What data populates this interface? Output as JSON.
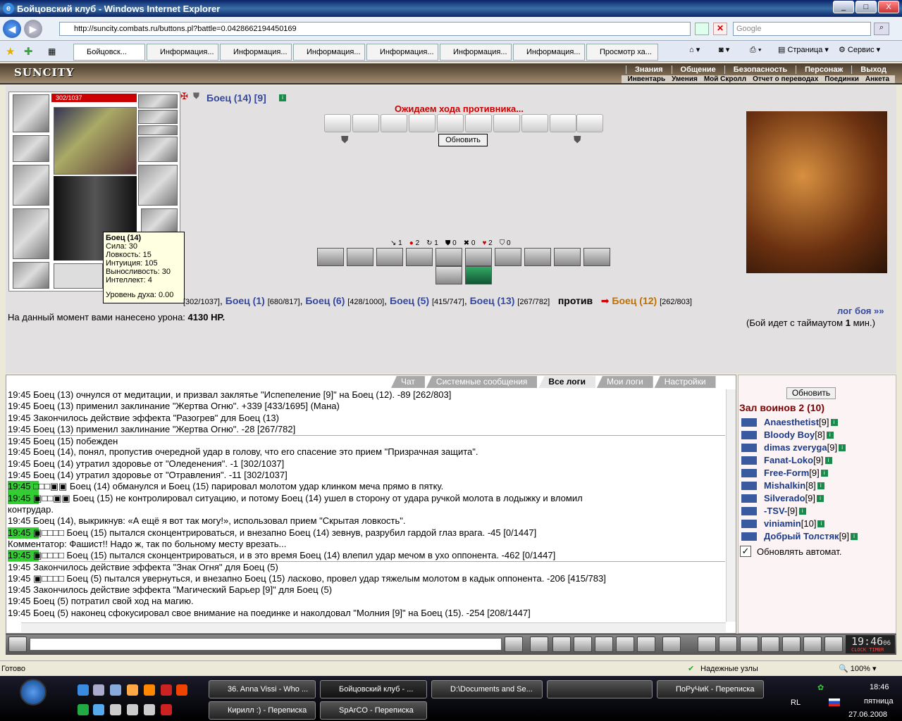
{
  "window": {
    "title": "Бойцовский клуб - Windows Internet Explorer",
    "url": "http://suncity.combats.ru/buttons.pl?battle=0.0428662194450169",
    "search_placeholder": "Google",
    "buttons": [
      "_",
      "□",
      "X"
    ]
  },
  "tabs": [
    {
      "label": "Бойцовск...",
      "active": true
    },
    {
      "label": "Информация..."
    },
    {
      "label": "Информация..."
    },
    {
      "label": "Информация..."
    },
    {
      "label": "Информация..."
    },
    {
      "label": "Информация..."
    },
    {
      "label": "Информация..."
    },
    {
      "label": "Просмотр ха..."
    }
  ],
  "ie_tools": {
    "page": "Страница",
    "service": "Сервис"
  },
  "game": {
    "logo": "SUNCITY",
    "menu_top": [
      "Знания",
      "Общение",
      "Безопасность",
      "Персонаж",
      "Выход"
    ],
    "menu_bottom": [
      "Инвентарь",
      "Умения",
      "Мой Скролл",
      "Отчет о переводах",
      "Поединки",
      "Анкета"
    ],
    "hp": "302/1037",
    "player_name": "Боец (14) [9]",
    "waiting": "Ожидаем хода противника...",
    "refresh": "Обновить",
    "stat_counts": [
      "1",
      "2",
      "1",
      "0",
      "0",
      "2",
      "0"
    ],
    "tooltip": {
      "title": "Боец (14)",
      "lines": [
        "Сила: 30",
        "Ловкость: 15",
        "Интуиция: 105",
        "Выносливость: 30",
        "Интеллект: 4"
      ],
      "spirit": "Уровень духа: 0.00"
    },
    "team_line": {
      "first_hp": "[302/1037]",
      "b1": "Боец (1)",
      "b1hp": "[680/817]",
      "b6": "Боец (6)",
      "b6hp": "[428/1000]",
      "b5": "Боец (5)",
      "b5hp": "[415/747]",
      "b13": "Боец (13)",
      "b13hp": "[267/782]",
      "vs": "против",
      "b12": "Боец (12)",
      "b12hp": "[262/803]"
    },
    "damage_text": "На данный момент вами нанесено урона:",
    "damage_value": "4130 HP.",
    "log_link": "лог боя »»",
    "timeout": "(Бой идет с таймаутом",
    "timeout_val": "1",
    "timeout_end": "мин.)"
  },
  "chat": {
    "tabs": [
      "Чат",
      "Системные сообщения",
      "Все логи",
      "Мои логи",
      "Настройки"
    ],
    "lines": [
      "19:45 Боец (13) очнулся от медитации, и призвал заклятье \"Испепеление [9]\" на Боец (12). -89 [262/803]",
      "19:45 Боец (13) применил заклинание \"Жертва Огню\". +339 [433/1695] (Мана)",
      "19:45 Закончилось действие эффекта \"Разогрев\" для Боец (13)",
      "19:45 Боец (13) применил заклинание \"Жертва Огню\". -28 [267/782]",
      "19:45 Боец (15) побежден",
      "19:45 Боец (14), понял, пропустив очередной удар в голову, что его спасение это прием \"Призрачная защита\".",
      "19:45 Боец (14) утратил здоровье от \"Оледенения\". -1 [302/1037]",
      "19:45 Боец (14) утратил здоровье от \"Отравления\". -11 [302/1037]",
      "19:45 □□□▣▣ Боец (14) обманулся и Боец (15) парировал молотом удар клинком меча прямо в пятку.",
      "19:45 ▣□□▣▣ Боец (15) не контролировал ситуацию, и потому Боец (14) ушел в сторону от удара ручкой молота в лодыжку и вломил",
      "контрудар.",
      "19:45 Боец (14), выкрикнув: «А ещё я вот так могу!», использовал прием \"Скрытая ловкость\".",
      "19:45 ▣□□□□ Боец (15) пытался сконцентрироваться, и внезапно Боец (14) зевнув, разрубил гардой глаз врага. -45 [0/1447]",
      "Комментатор: Фашист!! Надо ж, так по больному месту врезать...",
      "19:45 ▣□□□□ Боец (15) пытался сконцентрироваться, и в это время Боец (14) влепил удар мечом в ухо оппонента. -462 [0/1447]",
      "19:45 Закончилось действие эффекта \"Знак Огня\" для Боец (5)",
      "19:45 ▣□□□□ Боец (5) пытался увернуться, и внезапно Боец (15) ласково, провел удар тяжелым молотом в кадык оппонента. -206 [415/783]",
      "19:45 Закончилось действие эффекта \"Магический Барьер [9]\" для Боец (5)",
      "19:45 Боец (5) потратил свой ход на магию.",
      "19:45 Боец (5) наконец сфокусировал свое внимание на поединке и наколдовал \"Молния [9]\" на Боец (15). -254 [208/1447]"
    ]
  },
  "side": {
    "refresh": "Обновить",
    "room": "Зал воинов 2 (10)",
    "players": [
      {
        "name": "Anaesthetist",
        "lvl": "[9]"
      },
      {
        "name": "Bloody Boy",
        "lvl": "[8]"
      },
      {
        "name": "dimas zveryga",
        "lvl": "[9]"
      },
      {
        "name": "Fanat-Loko",
        "lvl": "[9]"
      },
      {
        "name": "Free-Form",
        "lvl": "[9]"
      },
      {
        "name": "Mishalkin",
        "lvl": "[8]"
      },
      {
        "name": "Silverado",
        "lvl": "[9]"
      },
      {
        "name": "-TSV-",
        "lvl": "[9]"
      },
      {
        "name": "viniamin",
        "lvl": "[10]"
      },
      {
        "name": "Добрый Толстяк",
        "lvl": "[9]"
      }
    ],
    "auto": "Обновлять автомат."
  },
  "clock": {
    "time": "19:46",
    "sec": "06",
    "label1": "CLOCK",
    "label2": "TIMER"
  },
  "status": {
    "left": "Готово",
    "zone": "Надежные узлы",
    "zoom": "100%"
  },
  "taskbar": {
    "items": [
      "36. Anna Vissi - Who ...",
      "Бойцовский клуб - ...",
      "D:\\Documents and Se...",
      "ПоРуЧиК - Переписка",
      "Кирилл :) - Переписка",
      "SpArCO - Переписка"
    ],
    "lang": "RL",
    "time": "18:46",
    "day": "пятница",
    "date": "27.06.2008"
  },
  "colors": {
    "name_blue": "#3448a0",
    "name_orange": "#c07000",
    "accent_red": "#c00000"
  }
}
